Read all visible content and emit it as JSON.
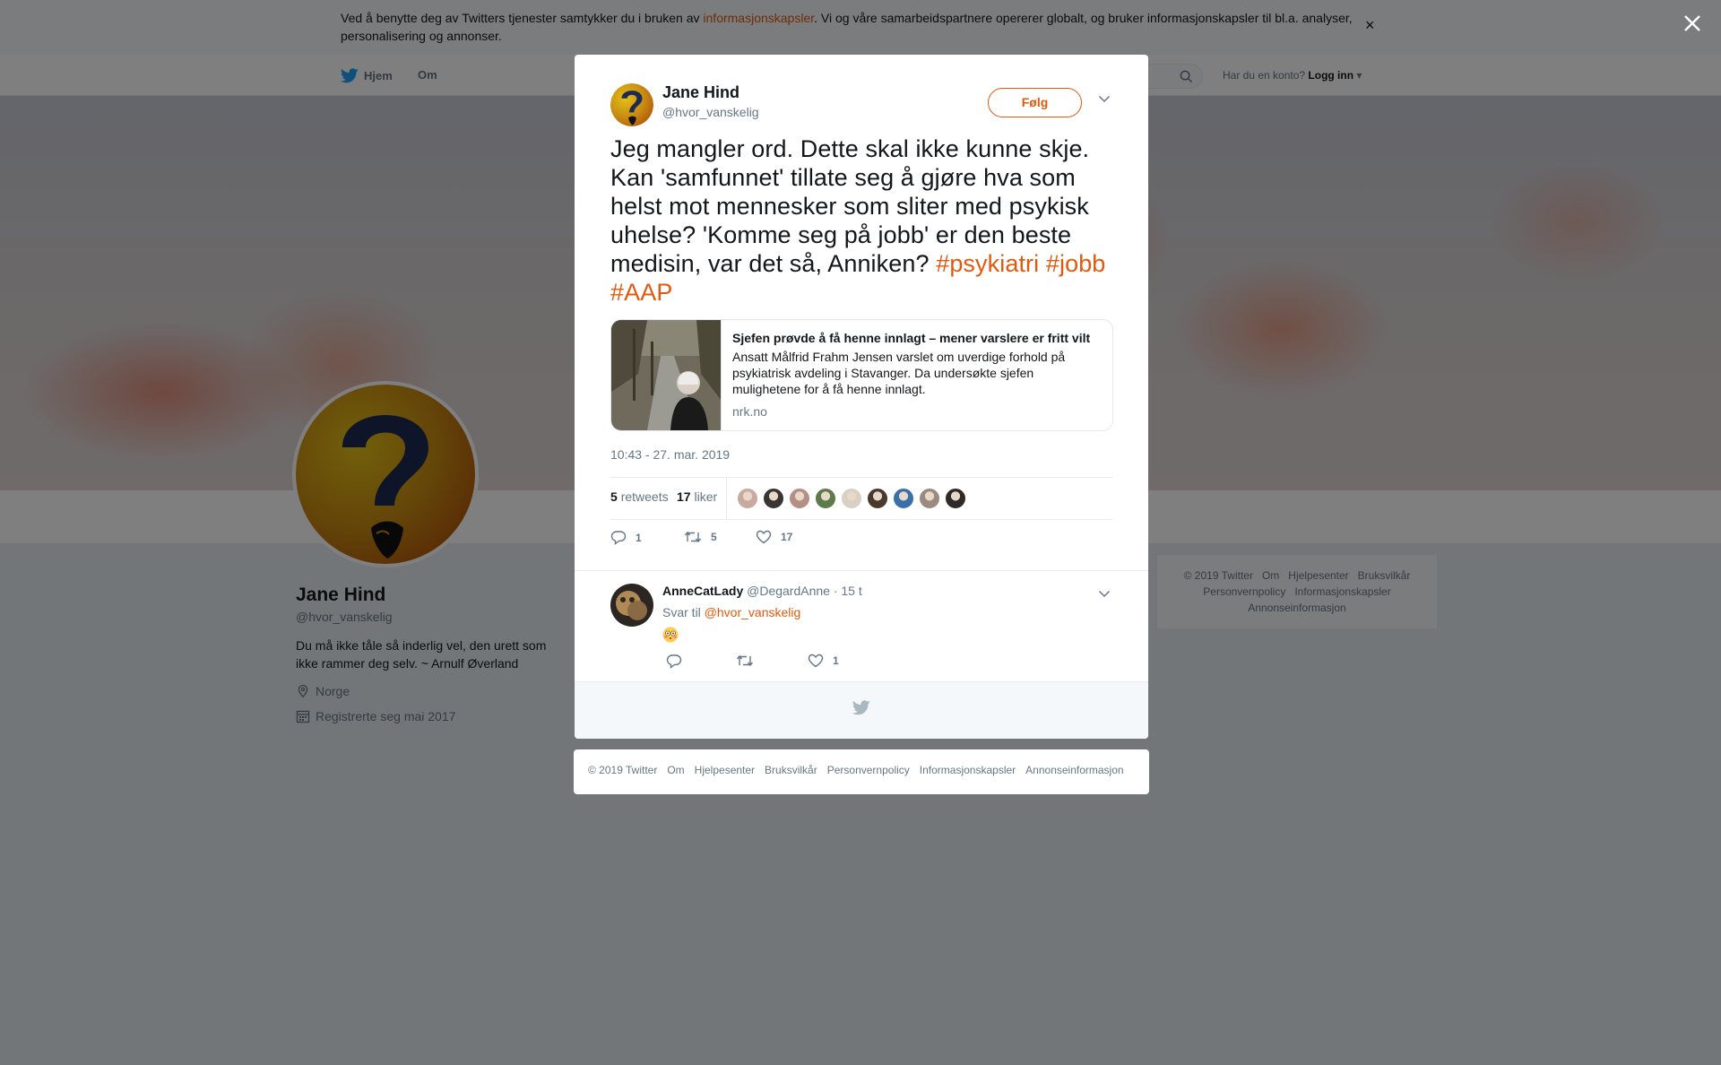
{
  "cookie_bar": {
    "text_before": "Ved å benytte deg av Twitters tjenester samtykker du i bruken av ",
    "link": "informasjonskapsler",
    "text_after": ". Vi og våre samarbeidspartnere opererer globalt, og bruker informasjonskapsler til bl.a. analyser, personalisering og annonser.",
    "close": "×"
  },
  "nav": {
    "home": "Hjem",
    "about": "Om",
    "account_prompt": "Har du en konto?",
    "login": "Logg inn"
  },
  "profile": {
    "name": "Jane Hind",
    "handle": "@hvor_vanskelig",
    "bio": "Du må ikke tåle så inderlig vel, den urett som ikke rammer deg selv. ~ Arnulf Øverland",
    "location": "Norge",
    "joined": "Registrerte seg mai 2017"
  },
  "side_footer": {
    "links": [
      "© 2019 Twitter",
      "Om",
      "Hjelpesenter",
      "Bruksvilkår",
      "Personvernpolicy",
      "Informasjonskapsler",
      "Annonseinformasjon"
    ]
  },
  "tweet": {
    "author_name": "Jane Hind",
    "author_handle": "@hvor_vanskelig",
    "follow_label": "Følg",
    "text": "Jeg mangler ord. Dette skal ikke kunne skje. Kan 'samfunnet' tillate seg å gjøre hva som helst mot mennesker som sliter med psykisk uhelse? 'Komme seg på jobb' er den beste medisin, var det så, Anniken? ",
    "hashtags": [
      "#psykiatri",
      "#jobb",
      "#AAP"
    ],
    "card": {
      "title": "Sjefen prøvde å få henne innlagt – mener varslere er fritt vilt",
      "description": "Ansatt Målfrid Frahm Jensen varslet om uverdige forhold på psykiatrisk avdeling i Stavanger. Da undersøkte sjefen mulighetene for å få henne innlagt.",
      "domain": "nrk.no"
    },
    "timestamp": "10:43 - 27. mar. 2019",
    "retweets_count": "5",
    "retweets_label": "retweets",
    "likes_count": "17",
    "likes_label": "liker",
    "likers": [
      "#c9a9a0",
      "#3a3535",
      "#b58f86",
      "#5d7a4a",
      "#d8d0c4",
      "#4a3a2e",
      "#3b6fa8",
      "#9a8a80",
      "#2e2a28"
    ],
    "actions": {
      "replies": "1",
      "retweets": "5",
      "likes": "17"
    }
  },
  "reply": {
    "name": "AnneCatLady",
    "handle": "@DegardAnne",
    "time": "· 15 t",
    "replying_to_label": "Svar til ",
    "replying_to_handle": "@hvor_vanskelig",
    "emoji": "flushed-face",
    "actions": {
      "replies": "",
      "retweets": "",
      "likes": "1"
    }
  },
  "bottom_links": [
    "© 2019 Twitter",
    "Om",
    "Hjelpesenter",
    "Bruksvilkår",
    "Personvernpolicy",
    "Informasjonskapsler",
    "Annonseinformasjon"
  ],
  "colors": {
    "accent": "#e0590d",
    "muted": "#657786",
    "overlay": "rgba(0,0,0,0.5)"
  }
}
